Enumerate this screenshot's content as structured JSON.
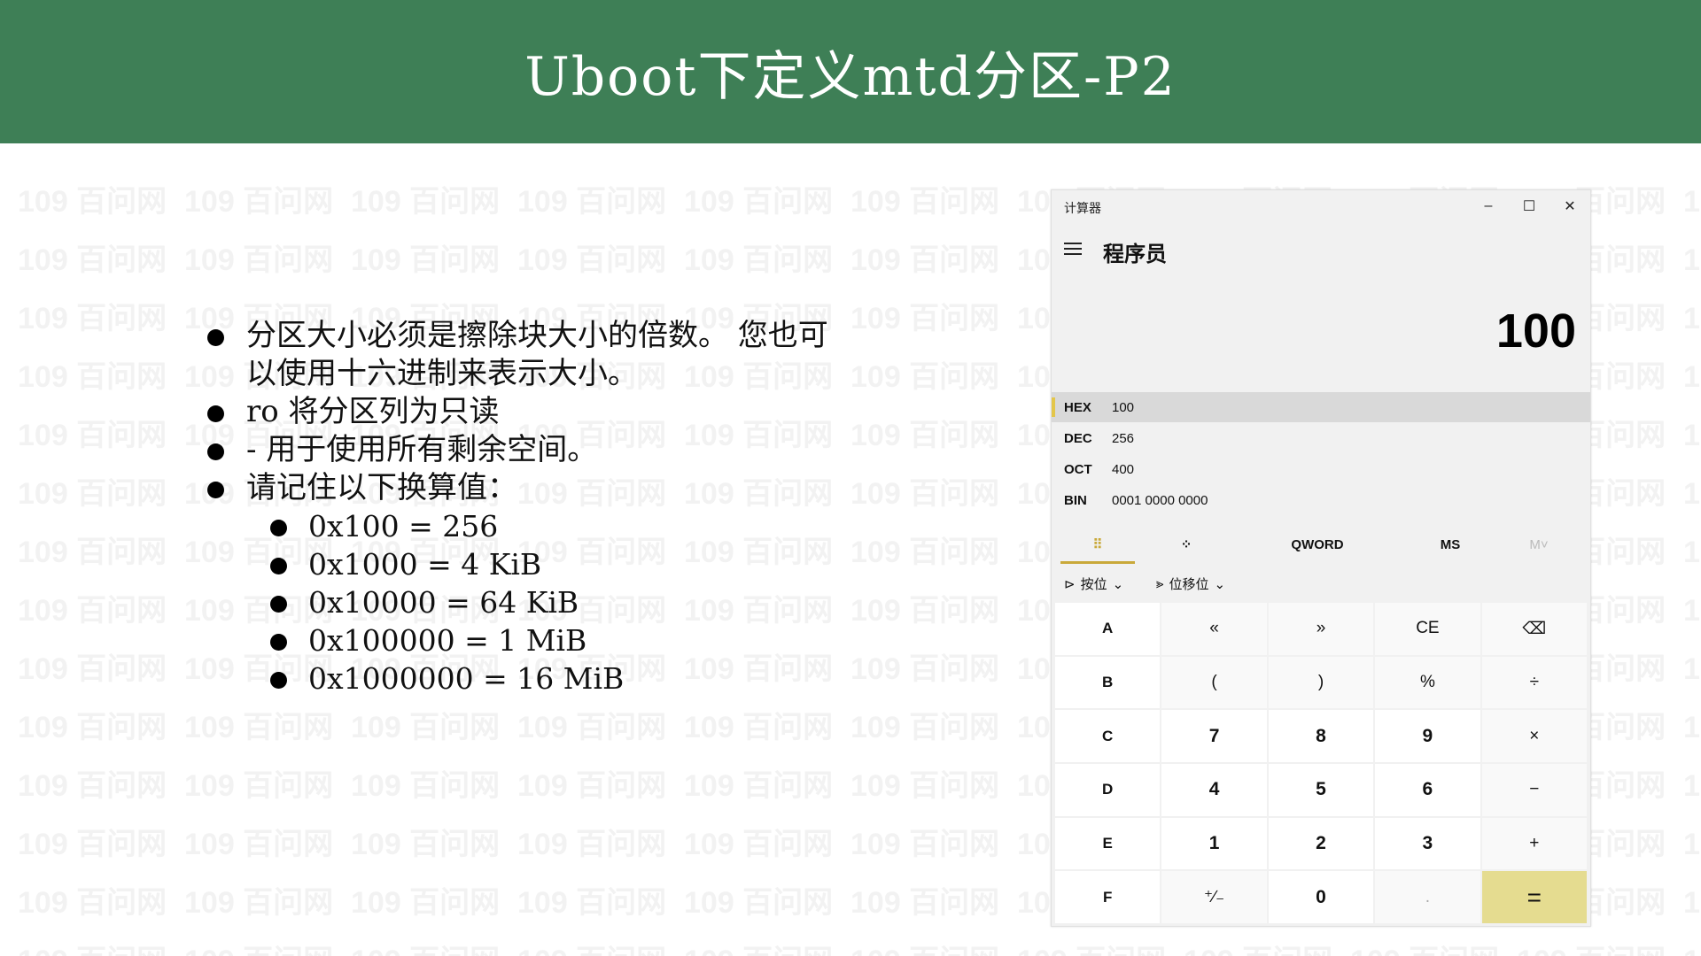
{
  "slide": {
    "title": "Uboot下定义mtd分区-P2",
    "bullets": [
      "分区大小必须是擦除块大小的倍数。 您也可以使用十六进制来表示大小。",
      "ro 将分区列为只读",
      "- 用于使用所有剩余空间。",
      "请记住以下换算值："
    ],
    "subbullets": [
      "0x100 = 256",
      "0x1000 = 4 KiB",
      "0x10000 = 64 KiB",
      "0x100000 = 1 MiB",
      "0x1000000 = 16 MiB"
    ],
    "watermark_text": "109 百问网"
  },
  "calculator": {
    "app_name": "计算器",
    "window_buttons": {
      "minimize": "–",
      "maximize": "☐",
      "close": "✕"
    },
    "mode": "程序员",
    "display": "100",
    "radix": [
      {
        "name": "HEX",
        "value": "100",
        "active": true
      },
      {
        "name": "DEC",
        "value": "256",
        "active": false
      },
      {
        "name": "OCT",
        "value": "400",
        "active": false
      },
      {
        "name": "BIN",
        "value": "0001 0000 0000",
        "active": false
      }
    ],
    "toolbar": {
      "keypad_icon": "⠿",
      "bit_toggle_icon": "⁘",
      "word_size": "QWORD",
      "memory_store": "MS",
      "memory_menu": "M˅"
    },
    "ops": {
      "bitwise_icon": "⊳",
      "bitwise": "按位",
      "bitshift_icon": "⪢",
      "bitshift": "位移位",
      "chevron": "⌄"
    },
    "keys": [
      "A",
      "«",
      "»",
      "CE",
      "⌫",
      "B",
      "(",
      ")",
      "%",
      "÷",
      "C",
      "7",
      "8",
      "9",
      "×",
      "D",
      "4",
      "5",
      "6",
      "−",
      "E",
      "1",
      "2",
      "3",
      "+",
      "F",
      "⁺∕₋",
      "0",
      ".",
      "="
    ],
    "colors": {
      "accent": "#e3c64a",
      "equals": "#e5dc90",
      "header_green": "#3e7f56"
    }
  }
}
